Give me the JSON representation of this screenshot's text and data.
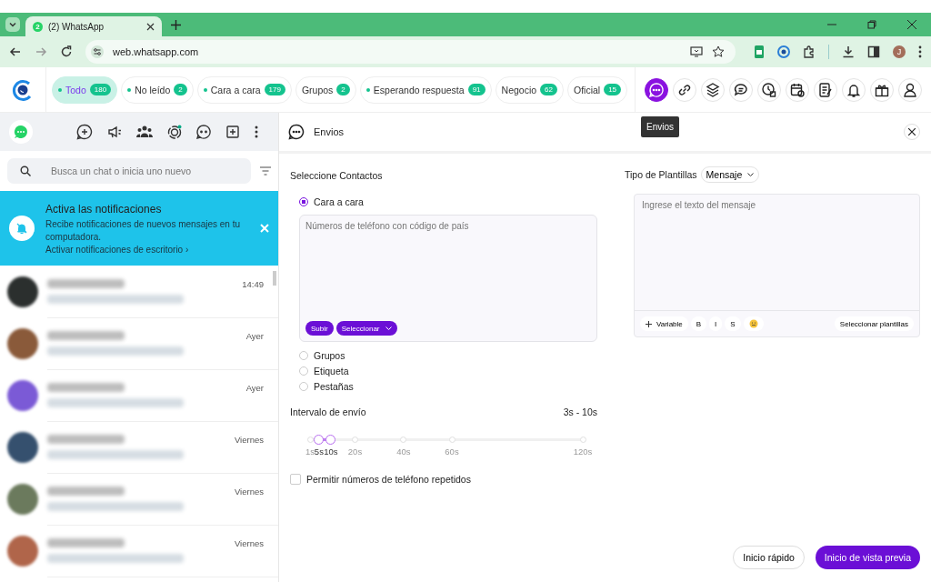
{
  "browser": {
    "tab": {
      "badge": "2",
      "title": "(2) WhatsApp"
    },
    "address": "web.whatsapp.com",
    "profile": "J"
  },
  "filters": [
    {
      "label": "Todo",
      "count": "180",
      "dot": true,
      "selected": true
    },
    {
      "label": "No leído",
      "count": "2",
      "dot": true,
      "selected": false
    },
    {
      "label": "Cara a cara",
      "count": "179",
      "dot": true,
      "selected": false
    },
    {
      "label": "Grupos",
      "count": "2",
      "dot": false,
      "selected": false
    },
    {
      "label": "Esperando respuesta",
      "count": "91",
      "dot": true,
      "selected": false
    },
    {
      "label": "Negocio",
      "count": "62",
      "dot": false,
      "selected": false
    },
    {
      "label": "Oficial",
      "count": "15",
      "dot": false,
      "selected": false
    }
  ],
  "tools": [
    {
      "selected": true
    },
    {
      "selected": false
    },
    {
      "selected": false
    },
    {
      "selected": false
    },
    {
      "selected": false
    },
    {
      "selected": false
    },
    {
      "selected": false
    },
    {
      "selected": false
    },
    {
      "selected": false
    },
    {
      "selected": false
    }
  ],
  "tooltip": "Envios",
  "sidebar": {
    "search_placeholder": "Busca un chat o inicia uno nuevo",
    "banner": {
      "title": "Activa las notificaciones",
      "text": "Recibe notificaciones de nuevos mensajes en tu computadora.",
      "link": "Activar notificaciones de escritorio ›"
    },
    "chats": [
      {
        "time": "14:49"
      },
      {
        "time": "Ayer"
      },
      {
        "time": "Ayer"
      },
      {
        "time": "Viernes"
      },
      {
        "time": "Viernes"
      },
      {
        "time": "Viernes"
      }
    ]
  },
  "panel": {
    "title": "Envios",
    "contacts_label": "Seleccione Contactos",
    "options": [
      {
        "label": "Cara a cara",
        "selected": true
      },
      {
        "label": "Grupos",
        "selected": false
      },
      {
        "label": "Etiqueta",
        "selected": false
      },
      {
        "label": "Pestañas",
        "selected": false
      }
    ],
    "phone_placeholder": "Números de teléfono con código de país",
    "upload_button": "Subir",
    "select_button": "Seleccionar",
    "interval": {
      "label": "Intervalo de envío",
      "reading": "3s - 10s",
      "ticks": [
        {
          "label": "1s",
          "selected": false
        },
        {
          "label": "5s",
          "selected": true
        },
        {
          "label": "10s",
          "selected": true
        },
        {
          "label": "20s",
          "selected": false
        },
        {
          "label": "40s",
          "selected": false
        },
        {
          "label": "60s",
          "selected": false
        },
        {
          "label": "120s",
          "selected": false
        }
      ]
    },
    "repeat": {
      "label": "Permitir números de teléfono repetidos",
      "checked": false
    },
    "template_label": "Tipo de Plantillas",
    "template_type": "Mensaje",
    "message_placeholder": "Ingrese el texto del mensaje",
    "editor_buttons": [
      "Variable",
      "B",
      "I",
      "S"
    ],
    "templates_button": "Seleccionar plantillas",
    "quick_button": "Inicio rápido",
    "preview_button": "Inicio de vista previa"
  }
}
